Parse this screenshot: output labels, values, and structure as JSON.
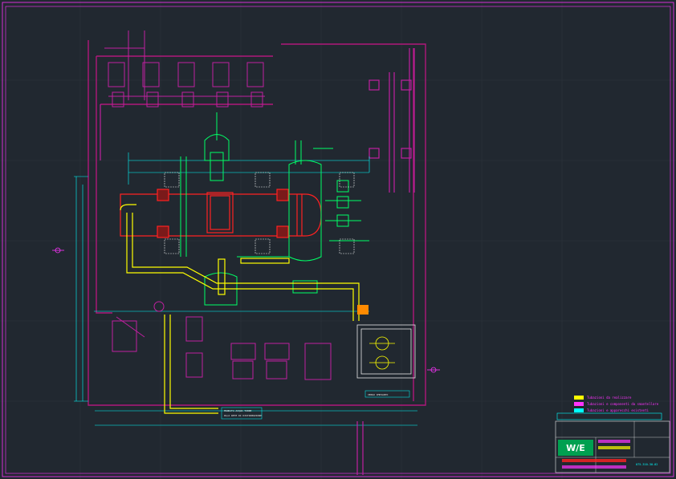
{
  "legend": {
    "items": [
      {
        "label": "Tubazioni da realizzare",
        "color": "#ffff00"
      },
      {
        "label": "Tubazioni e componenti da smantellare",
        "color": "#ff33ff"
      },
      {
        "label": "Tubazioni e apparecchi esistenti",
        "color": "#00ffff"
      }
    ]
  },
  "title_block": {
    "logo": "W/E",
    "drawing_number": "075-310-30-02"
  },
  "notes": {
    "bottom_label_line1": "MANDATA ACQUA TORRE",
    "bottom_label_line2": "DA/A RETE DI DISTRIBUZIONE",
    "right_label": "VERSO IMPIANTO"
  },
  "colors": {
    "background": "#212830",
    "border": "#ff33ff",
    "existing": "#00ffff",
    "new": "#ffff00",
    "dismantle": "#ff33ff",
    "equipment": "#00ff66",
    "vessel": "#ff2222"
  }
}
